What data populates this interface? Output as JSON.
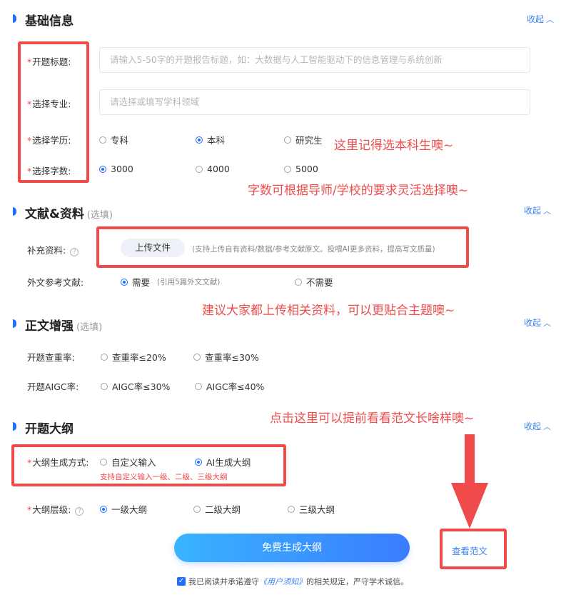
{
  "sections": {
    "basic": {
      "title": "基础信息",
      "collapse": "收起"
    },
    "literature": {
      "title": "文献&资料",
      "subtitle": "(选填)",
      "collapse": "收起"
    },
    "enhance": {
      "title": "正文增强",
      "subtitle": "(选填)",
      "collapse": "收起"
    },
    "outline": {
      "title": "开题大纲",
      "collapse": "收起"
    }
  },
  "basic": {
    "title_label": "开题标题:",
    "title_placeholder": "请输入5-50字的开题报告标题，如：大数据与人工智能驱动下的信息管理与系统创新",
    "major_label": "选择专业:",
    "major_placeholder": "请选择或填写学科领域",
    "degree_label": "选择学历:",
    "degree_options": [
      "专科",
      "本科",
      "研究生"
    ],
    "degree_selected": "本科",
    "words_label": "选择字数:",
    "words_options": [
      "3000",
      "4000",
      "5000"
    ],
    "words_selected": "3000",
    "required_mark": "*"
  },
  "literature": {
    "supplement_label": "补充资料:",
    "upload_button": "上传文件",
    "upload_hint": "(支持上传自有资料/数据/参考文献原文。投喂AI更多资料，提高写文质量)",
    "foreign_label": "外文参考文献:",
    "foreign_options": [
      "需要",
      "不需要"
    ],
    "foreign_selected": "需要",
    "foreign_hint": "(引用5篇外文文献)"
  },
  "enhance": {
    "dup_label": "开题查重率:",
    "dup_options": [
      "查重率≤20%",
      "查重率≤30%"
    ],
    "aigc_label": "开题AIGC率:",
    "aigc_options": [
      "AIGC率≤30%",
      "AIGC率≤40%"
    ]
  },
  "outline": {
    "method_label": "大纲生成方式:",
    "method_options": [
      "自定义输入",
      "AI生成大纲"
    ],
    "method_selected": "AI生成大纲",
    "method_hint": "支持自定义输入一级、二级、三级大纲",
    "level_label": "大纲层级:",
    "level_options": [
      "一级大纲",
      "二级大纲",
      "三级大纲"
    ],
    "level_selected": "一级大纲"
  },
  "actions": {
    "generate_button": "免费生成大纲",
    "sample_link": "查看范文",
    "agree_prefix": "我已阅读并承诺遵守",
    "agree_link": "《用户须知》",
    "agree_suffix": "的相关规定，严守学术诚信。"
  },
  "annotations": {
    "degree_note": "这里记得选本科生噢~",
    "words_note": "字数可根据导师/学校的要求灵活选择噢~",
    "upload_note": "建议大家都上传相关资料，可以更贴合主题噢~",
    "sample_note": "点击这里可以提前看看范文长啥样噢~"
  },
  "colors": {
    "accent": "#1f6fff",
    "annotation_red": "#ef4c4c",
    "link_blue": "#3b82f6"
  }
}
